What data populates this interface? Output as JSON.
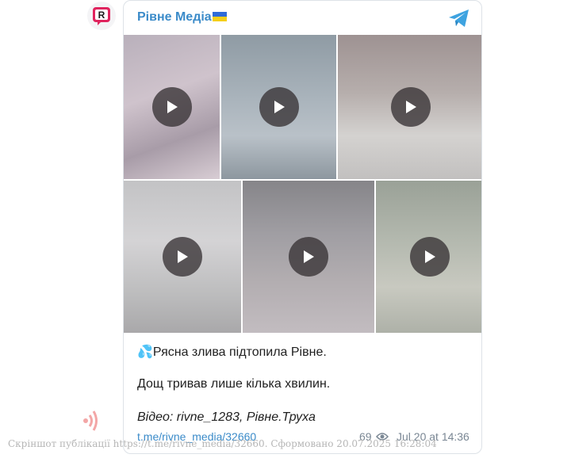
{
  "channel": {
    "name": "Рівне Медіа",
    "avatar_letter": "R",
    "accent_color": "#3b8bc9"
  },
  "media": {
    "item_count": 6,
    "item_type": "video",
    "play_icon": "play-icon"
  },
  "message": {
    "line1": "💦Рясна злива підтопила Рівне.",
    "line2": "Дощ тривав лише кілька хвилин.",
    "line3": "Відео: rivne_1283, Рівне.Труха"
  },
  "footer": {
    "link": "t.me/rivne_media/32660",
    "views": "69",
    "date": "Jul 20 at 14:36"
  },
  "watermark": "Скріншот публікації https://t.me/rivne_media/32660. Сформовано 20.07.2025 16:28:04"
}
